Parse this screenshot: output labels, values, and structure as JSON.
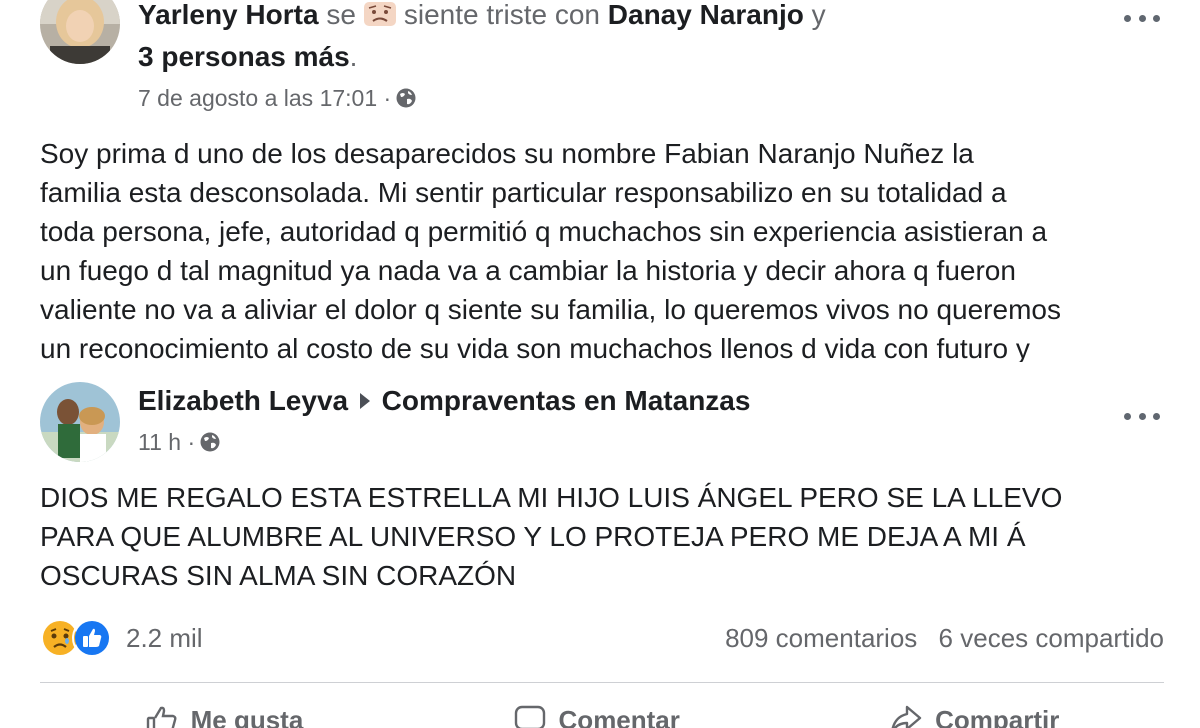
{
  "posts": [
    {
      "author": "Yarleny Horta",
      "feeling_prefix": "se",
      "feeling_text": "siente triste con",
      "tagged_person": "Danay Naranjo",
      "connector": "y",
      "others": "3 personas más",
      "others_suffix": ".",
      "timestamp": "7 de agosto a las 17:01 ·",
      "body": "Soy prima d uno de los desaparecidos su nombre Fabian Naranjo Nuñez  la\nfamilia esta desconsolada. Mi sentir particular responsabilizo en su totalidad a\ntoda persona, jefe, autoridad q permitió q muchachos sin experiencia asistieran a\nun fuego d tal magnitud ya nada va a cambiar la historia y decir ahora q fueron\nvaliente no va a aliviar el dolor q siente su familia, lo queremos vivos no queremos\nun reconocimiento al costo de su vida son muchachos llenos d vida con futuro y",
      "icons": {
        "avatar": "user-avatar",
        "feeling": "sad-face-icon",
        "audience": "globe-icon",
        "more": "more-options-icon"
      }
    },
    {
      "author": "Elizabeth Leyva",
      "group": "Compraventas en Matanzas",
      "timestamp": "11 h ·",
      "body": "DIOS ME REGALO ESTA ESTRELLA MI HIJO LUIS ÁNGEL PERO SE LA LLEVO\nPARA QUE ALUMBRE AL UNIVERSO Y LO PROTEJA PERO ME DEJA A MI Á\nOSCURAS SIN ALMA SIN CORAZÓN",
      "reaction_count": "2.2 mil",
      "comments": "809 comentarios",
      "shares": "6 veces compartido",
      "actions": {
        "like": "Me gusta",
        "comment": "Comentar",
        "share": "Compartir"
      },
      "icons": {
        "avatar": "user-avatar",
        "audience": "globe-icon",
        "more": "more-options-icon",
        "reactions": [
          "sad-reaction-icon",
          "like-reaction-icon"
        ]
      }
    }
  ],
  "colors": {
    "text": "#1c1e21",
    "muted": "#65676b",
    "like_blue": "#1877f2",
    "sad_yellow": "#f7b125",
    "divider": "#ced0d4"
  }
}
